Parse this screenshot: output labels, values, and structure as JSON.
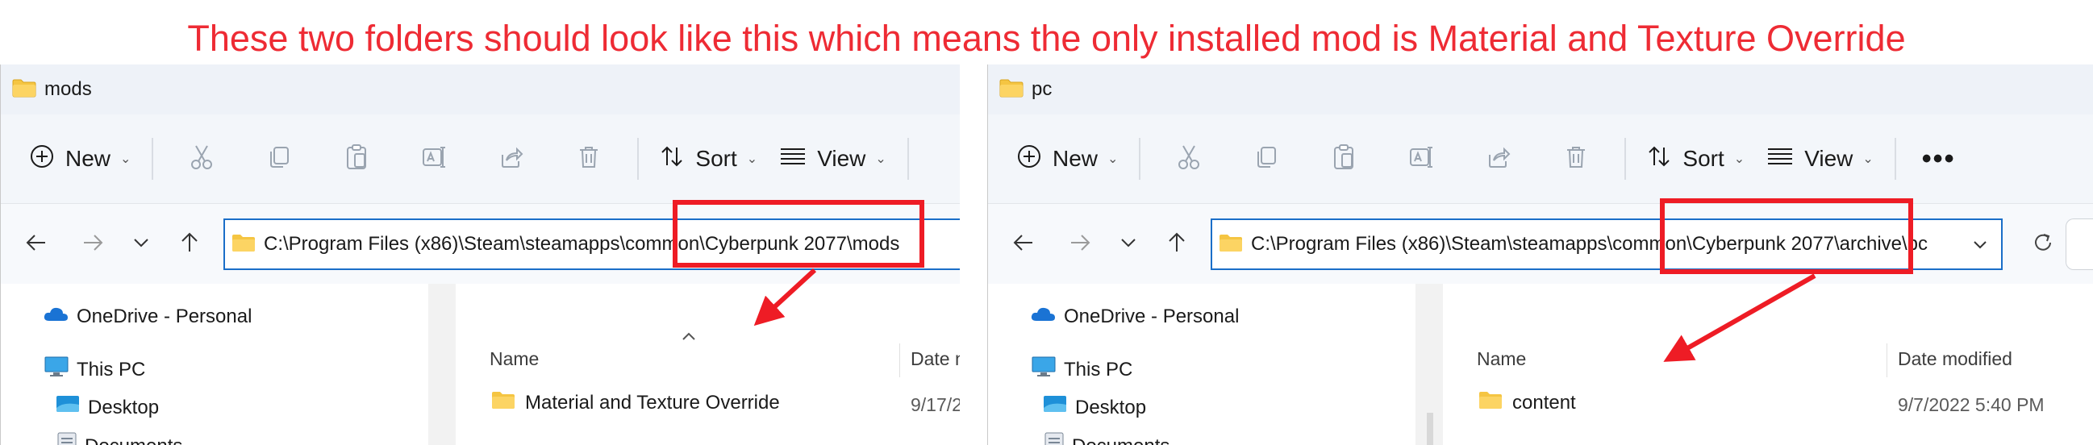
{
  "caption": "These two folders should look like this which means the only installed mod is Material and Texture Override",
  "colors": {
    "caption": "#ee2b34",
    "highlight": "#ee1c25",
    "folder": "#f5c542",
    "accent": "#1a6ec8"
  },
  "toolbar": {
    "new_label": "New",
    "sort_label": "Sort",
    "view_label": "View",
    "more_label": "•••"
  },
  "left_window": {
    "title": "mods",
    "address": "C:\\Program Files (x86)\\Steam\\steamapps\\common\\Cyberpunk 2077\\mods",
    "nav_items": [
      "OneDrive - Personal",
      "This PC",
      "Desktop",
      "Documents"
    ],
    "columns": {
      "name": "Name",
      "date": "Date m"
    },
    "files": [
      {
        "name": "Material and Texture Override",
        "date": "9/17/2"
      }
    ]
  },
  "right_window": {
    "title": "pc",
    "address": "C:\\Program Files (x86)\\Steam\\steamapps\\common\\Cyberpunk 2077\\archive\\pc",
    "nav_items": [
      "OneDrive - Personal",
      "This PC",
      "Desktop",
      "Documents"
    ],
    "columns": {
      "name": "Name",
      "date": "Date modified"
    },
    "files": [
      {
        "name": "content",
        "date": "9/7/2022 5:40 PM"
      }
    ]
  }
}
